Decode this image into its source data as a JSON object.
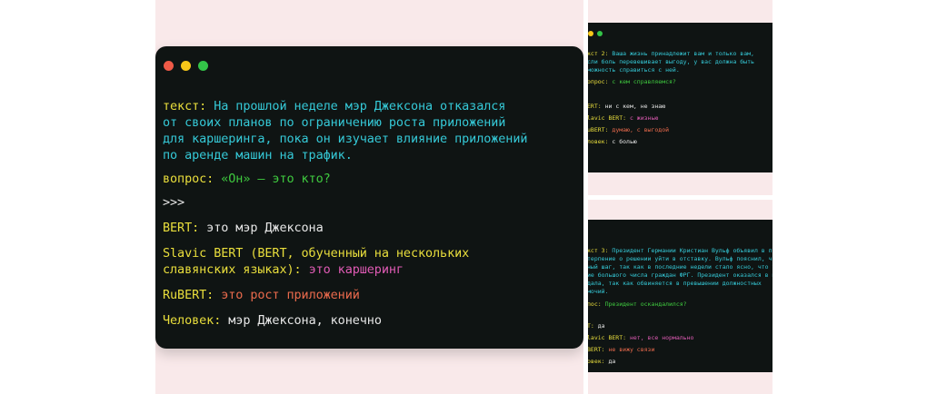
{
  "main": {
    "text_label": "текст:",
    "text_lines": [
      "На прошлой неделе мэр Джексона отказался",
      "от своих планов по ограничению роста приложений",
      "для каршеринга, пока он изучает влияние приложений",
      "по аренде машин на трафик."
    ],
    "question_label": "вопрос:",
    "question": "«Он» — это кто?",
    "prompt": ">>>",
    "answers": {
      "bert_label": "BERT:",
      "bert": "это мэр Джексона",
      "slavic_label_1": "Slavic BERT (BERT, обученный на нескольких",
      "slavic_label_2": "славянских языках):",
      "slavic": "это каршеринг",
      "rubert_label": "RuBERT:",
      "rubert": "это рост приложений",
      "human_label": "Человек:",
      "human": "мэр Джексона, конечно"
    }
  },
  "top_right": {
    "text_label": "кст 2:",
    "text_lines": [
      "Ваша жизнь принадлежит вам и только вам,",
      "сли боль перевешивает выгоду, у вас должна быть",
      "можность справиться с ней."
    ],
    "question_label": "опрос:",
    "question": "с кем справляемся?",
    "bert_label": "ERT:",
    "bert": "ни с кем, не знаю",
    "slavic_label": "lavic BERT:",
    "slavic": "с жизнью",
    "rubert_label": "uBERT:",
    "rubert": "думаю, с выгодой",
    "human_label": "ловек:",
    "human": "с болью"
  },
  "bottom_right": {
    "text_label": "кст 3:",
    "text_first": "Президент Германии Кристиан Вульф объявил в пятницу",
    "text_lines": [
      "терпение о решении уйти в отставку. Вульф пояснил, что пошел",
      "ный шаг, так как в последние недели стало ясно, что утратил",
      "ие большого числа граждан ФРГ. Президент оказался в центре",
      "дала, так как обвиняется в превышении должностных",
      "мочий."
    ],
    "question_label": "пос:",
    "question": "Президент оскандалился?",
    "bert_label": "T:",
    "bert": "да",
    "slavic_label": "lavic BERT:",
    "slavic": "нет, все нормально",
    "rubert_label": "BERT:",
    "rubert": "не вижу связи",
    "human_label": "овек:",
    "human": "да"
  },
  "colors": {
    "label": "#e9de3c",
    "text": "#35c9d7",
    "question": "#3fca3f",
    "slavic": "#e05bb5",
    "rubert": "#ea6a4c",
    "terminal_bg": "#0f1413",
    "page_bg": "#f9e9ea"
  }
}
